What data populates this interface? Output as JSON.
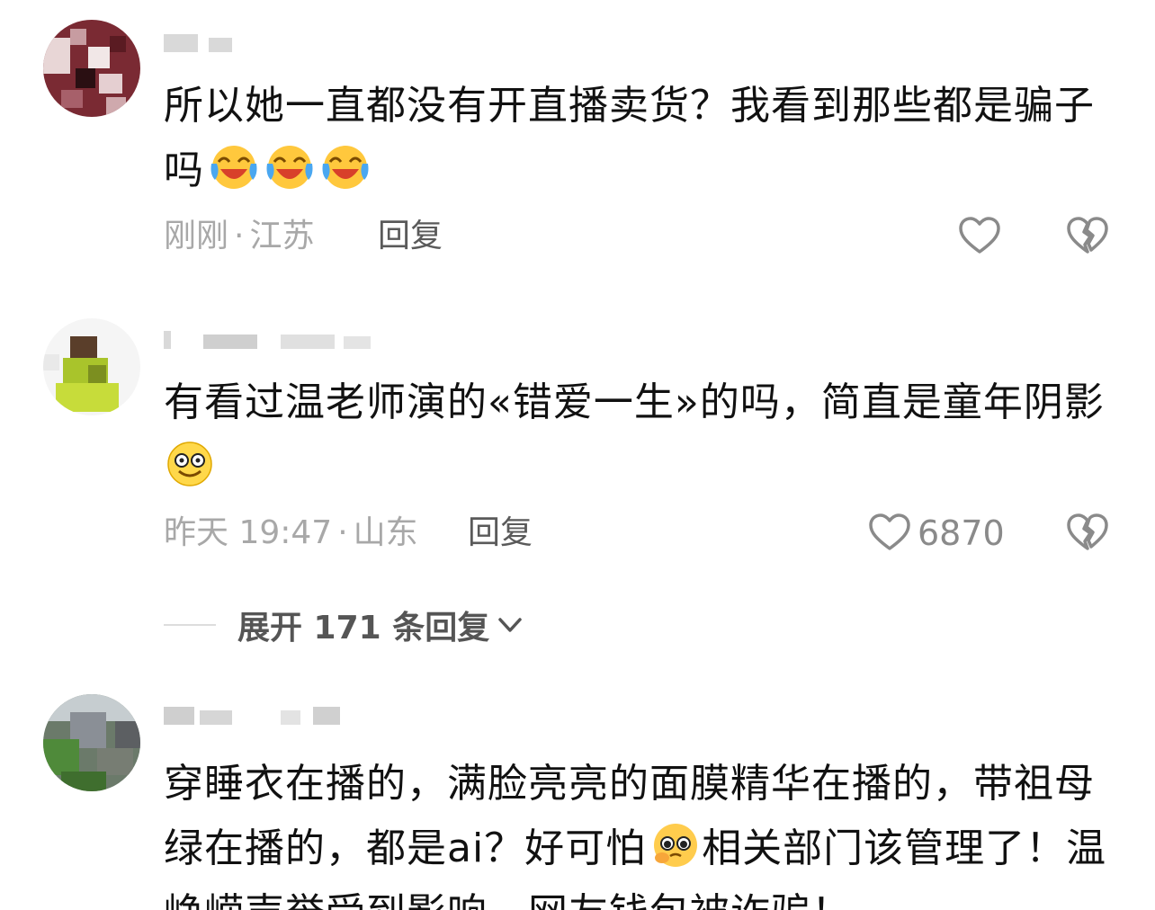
{
  "comments": [
    {
      "username": "",
      "text": "所以她一直都没有开直播卖货？我看到那些都是骗子吗",
      "emoji": "crying-laughing-emoji",
      "time": "刚刚",
      "location": "江苏",
      "reply_label": "回复",
      "like_count": ""
    },
    {
      "username": "",
      "text": "有看过温老师演的«错爱一生»的吗，简直是童年阴影",
      "emoji": "dizzy-smile-emoji",
      "time": "昨天 19:47",
      "location": "山东",
      "reply_label": "回复",
      "like_count": "6870"
    },
    {
      "username": "",
      "text_part1": "穿睡衣在播的，满脸亮亮的面膜精华在播的，带祖母绿在播的，都是ai？好可怕",
      "emoji": "pleading-emoji",
      "text_part2": "相关部门该管理了！温峥嵘声誉受到影响，网友钱包被诈骗！"
    }
  ],
  "expand_replies": {
    "label": "展开 171 条回复"
  },
  "separator": "·",
  "colors": {
    "text": "#111111",
    "meta": "#a8a8a8",
    "reply": "#5a5a5a",
    "icon": "#8a8a8a"
  }
}
